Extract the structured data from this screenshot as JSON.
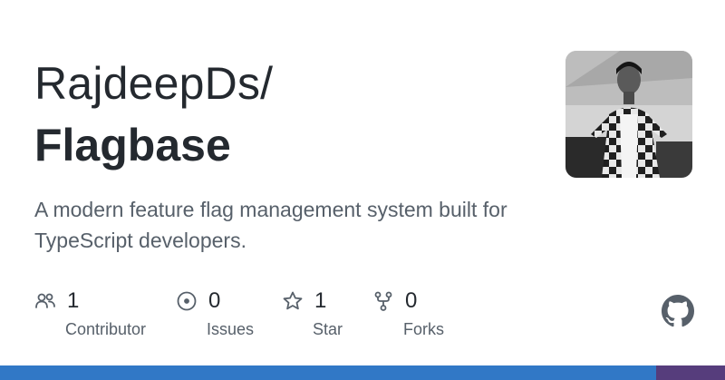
{
  "repo": {
    "owner": "RajdeepDs/",
    "name": "Flagbase",
    "description": "A modern feature flag management system built for TypeScript developers."
  },
  "avatar": {
    "icon": "avatar-photo"
  },
  "stats": [
    {
      "icon": "people-icon",
      "count": "1",
      "label": "Contributor"
    },
    {
      "icon": "issue-icon",
      "count": "0",
      "label": "Issues"
    },
    {
      "icon": "star-icon",
      "count": "1",
      "label": "Star"
    },
    {
      "icon": "fork-icon",
      "count": "0",
      "label": "Forks"
    }
  ],
  "logo": {
    "icon": "github-icon"
  },
  "language_bar": {
    "colors": [
      "#3178c6",
      "#563d7c"
    ],
    "fractions": [
      0.905,
      0.095
    ]
  }
}
